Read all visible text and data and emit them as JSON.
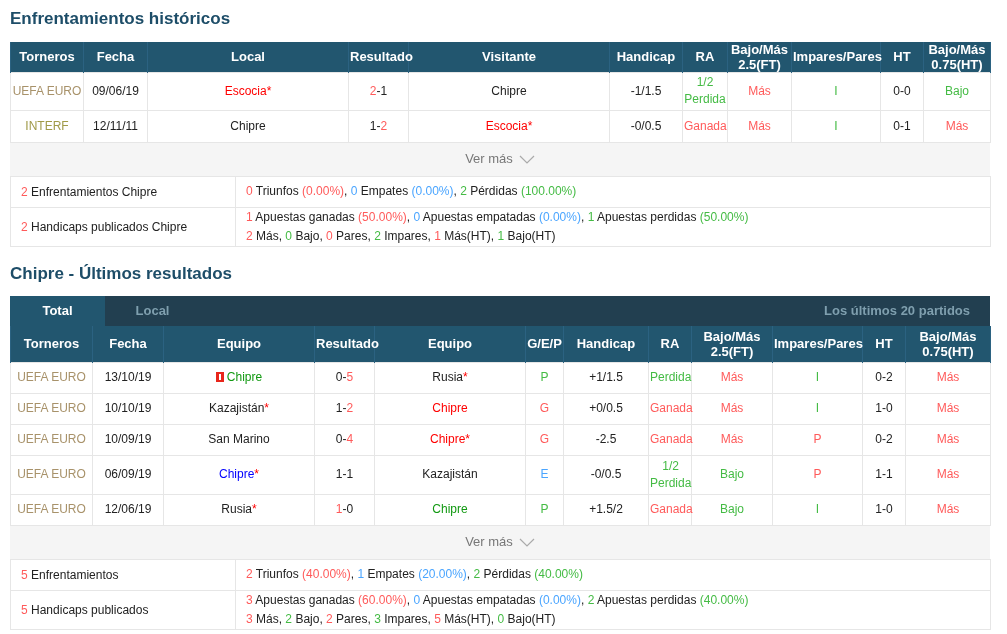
{
  "sections": [
    {
      "title": "Enfrentamientos históricos",
      "columns": [
        "Torneros",
        "Fecha",
        "Local",
        "Resultado",
        "Visitante",
        "Handicap",
        "RA",
        "Bajo/Más 2.5(FT)",
        "Impares/Pares",
        "HT",
        "Bajo/Más 0.75(HT)"
      ],
      "rows": [
        [
          [
            {
              "text": "UEFA EURO",
              "kind": "league",
              "color": "#a8926a"
            }
          ],
          [
            {
              "text": "09/06/19",
              "kind": "plain"
            }
          ],
          [
            {
              "text": "Escocia*",
              "kind": "team-win"
            }
          ],
          [
            {
              "text": "2",
              "kind": "win"
            },
            {
              "text": "-1",
              "kind": "plain"
            }
          ],
          [
            {
              "text": "Chipre",
              "kind": "plain"
            }
          ],
          [
            {
              "text": "-1/1.5",
              "kind": "plain"
            }
          ],
          [
            {
              "text": "1/2 Perdida",
              "kind": "loss"
            }
          ],
          [
            {
              "text": "Más",
              "kind": "win"
            }
          ],
          [
            {
              "text": "I",
              "kind": "loss"
            }
          ],
          [
            {
              "text": "0-0",
              "kind": "plain"
            }
          ],
          [
            {
              "text": "Bajo",
              "kind": "loss"
            }
          ]
        ],
        [
          [
            {
              "text": "INTERF",
              "kind": "league",
              "color": "#a09a48"
            }
          ],
          [
            {
              "text": "12/11/11",
              "kind": "plain"
            }
          ],
          [
            {
              "text": "Chipre",
              "kind": "plain"
            }
          ],
          [
            {
              "text": "1-",
              "kind": "plain"
            },
            {
              "text": "2",
              "kind": "win"
            }
          ],
          [
            {
              "text": "Escocia*",
              "kind": "team-win"
            }
          ],
          [
            {
              "text": "-0/0.5",
              "kind": "plain"
            }
          ],
          [
            {
              "text": "Ganada",
              "kind": "win"
            }
          ],
          [
            {
              "text": "Más",
              "kind": "win"
            }
          ],
          [
            {
              "text": "I",
              "kind": "loss"
            }
          ],
          [
            {
              "text": "0-1",
              "kind": "plain"
            }
          ],
          [
            {
              "text": "Más",
              "kind": "win"
            }
          ]
        ]
      ],
      "more": "Ver más",
      "summary": [
        {
          "label": [
            {
              "text": "2",
              "kind": "win"
            },
            {
              "text": " Enfrentamientos Chipre",
              "kind": "plain"
            }
          ],
          "lines": [
            [
              {
                "text": "0",
                "kind": "win"
              },
              {
                "text": " Triunfos ",
                "kind": "plain"
              },
              {
                "text": "(0.00%)",
                "kind": "win"
              },
              {
                "text": ", ",
                "kind": "plain"
              },
              {
                "text": "0",
                "kind": "draw"
              },
              {
                "text": " Empates ",
                "kind": "plain"
              },
              {
                "text": "(0.00%)",
                "kind": "draw"
              },
              {
                "text": ", ",
                "kind": "plain"
              },
              {
                "text": "2",
                "kind": "loss"
              },
              {
                "text": " Pérdidas ",
                "kind": "plain"
              },
              {
                "text": "(100.00%)",
                "kind": "loss"
              }
            ]
          ]
        },
        {
          "label": [
            {
              "text": "2",
              "kind": "win"
            },
            {
              "text": " Handicaps publicados Chipre",
              "kind": "plain"
            }
          ],
          "lines": [
            [
              {
                "text": "1",
                "kind": "win"
              },
              {
                "text": " Apuestas ganadas ",
                "kind": "plain"
              },
              {
                "text": "(50.00%)",
                "kind": "win"
              },
              {
                "text": ", ",
                "kind": "plain"
              },
              {
                "text": "0",
                "kind": "draw"
              },
              {
                "text": " Apuestas empatadas ",
                "kind": "plain"
              },
              {
                "text": "(0.00%)",
                "kind": "draw"
              },
              {
                "text": ", ",
                "kind": "plain"
              },
              {
                "text": "1",
                "kind": "loss"
              },
              {
                "text": " Apuestas perdidas ",
                "kind": "plain"
              },
              {
                "text": "(50.00%)",
                "kind": "loss"
              }
            ],
            [
              {
                "text": "2",
                "kind": "win"
              },
              {
                "text": " Más, ",
                "kind": "plain"
              },
              {
                "text": "0",
                "kind": "loss"
              },
              {
                "text": " Bajo, ",
                "kind": "plain"
              },
              {
                "text": "0",
                "kind": "win"
              },
              {
                "text": " Pares, ",
                "kind": "plain"
              },
              {
                "text": "2",
                "kind": "loss"
              },
              {
                "text": " Impares, ",
                "kind": "plain"
              },
              {
                "text": "1",
                "kind": "win"
              },
              {
                "text": " Más(HT), ",
                "kind": "plain"
              },
              {
                "text": "1",
                "kind": "loss"
              },
              {
                "text": " Bajo(HT)",
                "kind": "plain"
              }
            ]
          ]
        }
      ]
    },
    {
      "title": "Chipre - Últimos resultados",
      "tabs": [
        {
          "label": "Total",
          "selected": true
        },
        {
          "label": "Local",
          "selected": false
        }
      ],
      "tab_note": "Los últimos 20 partidos",
      "columns": [
        "Torneros",
        "Fecha",
        "Equipo",
        "Resultado",
        "Equipo",
        "G/E/P",
        "Handicap",
        "RA",
        "Bajo/Más 2.5(FT)",
        "Impares/Pares",
        "HT",
        "Bajo/Más 0.75(HT)"
      ],
      "rows": [
        [
          [
            {
              "text": "UEFA EURO",
              "kind": "league",
              "color": "#a8926a"
            }
          ],
          [
            {
              "text": "13/10/19",
              "kind": "plain"
            }
          ],
          [
            {
              "text": "",
              "kind": "card"
            },
            {
              "text": "Chipre",
              "kind": "team-loss"
            }
          ],
          [
            {
              "text": "0-",
              "kind": "plain"
            },
            {
              "text": "5",
              "kind": "win"
            }
          ],
          [
            {
              "text": "Rusia",
              "kind": "plain"
            },
            {
              "text": "*",
              "kind": "star"
            }
          ],
          [
            {
              "text": "P",
              "kind": "loss"
            }
          ],
          [
            {
              "text": "+1/1.5",
              "kind": "plain"
            }
          ],
          [
            {
              "text": "Perdida",
              "kind": "loss"
            }
          ],
          [
            {
              "text": "Más",
              "kind": "win"
            }
          ],
          [
            {
              "text": "I",
              "kind": "loss"
            }
          ],
          [
            {
              "text": "0-2",
              "kind": "plain"
            }
          ],
          [
            {
              "text": "Más",
              "kind": "win"
            }
          ]
        ],
        [
          [
            {
              "text": "UEFA EURO",
              "kind": "league",
              "color": "#a8926a"
            }
          ],
          [
            {
              "text": "10/10/19",
              "kind": "plain"
            }
          ],
          [
            {
              "text": "Kazajistán",
              "kind": "plain"
            },
            {
              "text": "*",
              "kind": "star"
            }
          ],
          [
            {
              "text": "1-",
              "kind": "plain"
            },
            {
              "text": "2",
              "kind": "win"
            }
          ],
          [
            {
              "text": "Chipre",
              "kind": "team-win"
            }
          ],
          [
            {
              "text": "G",
              "kind": "win"
            }
          ],
          [
            {
              "text": "+0/0.5",
              "kind": "plain"
            }
          ],
          [
            {
              "text": "Ganada",
              "kind": "win"
            }
          ],
          [
            {
              "text": "Más",
              "kind": "win"
            }
          ],
          [
            {
              "text": "I",
              "kind": "loss"
            }
          ],
          [
            {
              "text": "1-0",
              "kind": "plain"
            }
          ],
          [
            {
              "text": "Más",
              "kind": "win"
            }
          ]
        ],
        [
          [
            {
              "text": "UEFA EURO",
              "kind": "league",
              "color": "#a8926a"
            }
          ],
          [
            {
              "text": "10/09/19",
              "kind": "plain"
            }
          ],
          [
            {
              "text": "San Marino",
              "kind": "plain"
            }
          ],
          [
            {
              "text": "0-",
              "kind": "plain"
            },
            {
              "text": "4",
              "kind": "win"
            }
          ],
          [
            {
              "text": "Chipre*",
              "kind": "team-win"
            }
          ],
          [
            {
              "text": "G",
              "kind": "win"
            }
          ],
          [
            {
              "text": "-2.5",
              "kind": "plain"
            }
          ],
          [
            {
              "text": "Ganada",
              "kind": "win"
            }
          ],
          [
            {
              "text": "Más",
              "kind": "win"
            }
          ],
          [
            {
              "text": "P",
              "kind": "win"
            }
          ],
          [
            {
              "text": "0-2",
              "kind": "plain"
            }
          ],
          [
            {
              "text": "Más",
              "kind": "win"
            }
          ]
        ],
        [
          [
            {
              "text": "UEFA EURO",
              "kind": "league",
              "color": "#a8926a"
            }
          ],
          [
            {
              "text": "06/09/19",
              "kind": "plain"
            }
          ],
          [
            {
              "text": "Chipre",
              "kind": "team-draw"
            },
            {
              "text": "*",
              "kind": "star"
            }
          ],
          [
            {
              "text": "1-1",
              "kind": "plain"
            }
          ],
          [
            {
              "text": "Kazajistán",
              "kind": "plain"
            }
          ],
          [
            {
              "text": "E",
              "kind": "draw"
            }
          ],
          [
            {
              "text": "-0/0.5",
              "kind": "plain"
            }
          ],
          [
            {
              "text": "1/2 Perdida",
              "kind": "loss"
            }
          ],
          [
            {
              "text": "Bajo",
              "kind": "loss"
            }
          ],
          [
            {
              "text": "P",
              "kind": "win"
            }
          ],
          [
            {
              "text": "1-1",
              "kind": "plain"
            }
          ],
          [
            {
              "text": "Más",
              "kind": "win"
            }
          ]
        ],
        [
          [
            {
              "text": "UEFA EURO",
              "kind": "league",
              "color": "#a8926a"
            }
          ],
          [
            {
              "text": "12/06/19",
              "kind": "plain"
            }
          ],
          [
            {
              "text": "Rusia",
              "kind": "plain"
            },
            {
              "text": "*",
              "kind": "star"
            }
          ],
          [
            {
              "text": "1",
              "kind": "win"
            },
            {
              "text": "-0",
              "kind": "plain"
            }
          ],
          [
            {
              "text": "Chipre",
              "kind": "team-loss"
            }
          ],
          [
            {
              "text": "P",
              "kind": "loss"
            }
          ],
          [
            {
              "text": "+1.5/2",
              "kind": "plain"
            }
          ],
          [
            {
              "text": "Ganada",
              "kind": "win"
            }
          ],
          [
            {
              "text": "Bajo",
              "kind": "loss"
            }
          ],
          [
            {
              "text": "I",
              "kind": "loss"
            }
          ],
          [
            {
              "text": "1-0",
              "kind": "plain"
            }
          ],
          [
            {
              "text": "Más",
              "kind": "win"
            }
          ]
        ]
      ],
      "more": "Ver más",
      "summary": [
        {
          "label": [
            {
              "text": "5",
              "kind": "win"
            },
            {
              "text": " Enfrentamientos",
              "kind": "plain"
            }
          ],
          "lines": [
            [
              {
                "text": "2",
                "kind": "win"
              },
              {
                "text": " Triunfos ",
                "kind": "plain"
              },
              {
                "text": "(40.00%)",
                "kind": "win"
              },
              {
                "text": ", ",
                "kind": "plain"
              },
              {
                "text": "1",
                "kind": "draw"
              },
              {
                "text": " Empates ",
                "kind": "plain"
              },
              {
                "text": "(20.00%)",
                "kind": "draw"
              },
              {
                "text": ", ",
                "kind": "plain"
              },
              {
                "text": "2",
                "kind": "loss"
              },
              {
                "text": " Pérdidas ",
                "kind": "plain"
              },
              {
                "text": "(40.00%)",
                "kind": "loss"
              }
            ]
          ]
        },
        {
          "label": [
            {
              "text": "5",
              "kind": "win"
            },
            {
              "text": " Handicaps publicados",
              "kind": "plain"
            }
          ],
          "lines": [
            [
              {
                "text": "3",
                "kind": "win"
              },
              {
                "text": " Apuestas ganadas ",
                "kind": "plain"
              },
              {
                "text": "(60.00%)",
                "kind": "win"
              },
              {
                "text": ", ",
                "kind": "plain"
              },
              {
                "text": "0",
                "kind": "draw"
              },
              {
                "text": " Apuestas empatadas ",
                "kind": "plain"
              },
              {
                "text": "(0.00%)",
                "kind": "draw"
              },
              {
                "text": ", ",
                "kind": "plain"
              },
              {
                "text": "2",
                "kind": "loss"
              },
              {
                "text": " Apuestas perdidas ",
                "kind": "plain"
              },
              {
                "text": "(40.00%)",
                "kind": "loss"
              }
            ],
            [
              {
                "text": "3",
                "kind": "win"
              },
              {
                "text": " Más, ",
                "kind": "plain"
              },
              {
                "text": "2",
                "kind": "loss"
              },
              {
                "text": " Bajo, ",
                "kind": "plain"
              },
              {
                "text": "2",
                "kind": "win"
              },
              {
                "text": " Pares, ",
                "kind": "plain"
              },
              {
                "text": "3",
                "kind": "loss"
              },
              {
                "text": " Impares, ",
                "kind": "plain"
              },
              {
                "text": "5",
                "kind": "win"
              },
              {
                "text": " Más(HT), ",
                "kind": "plain"
              },
              {
                "text": "0",
                "kind": "loss"
              },
              {
                "text": " Bajo(HT)",
                "kind": "plain"
              }
            ]
          ]
        }
      ]
    }
  ]
}
